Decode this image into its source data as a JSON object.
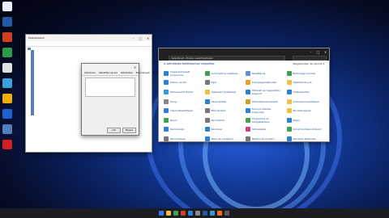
{
  "desktop_icons": [
    {
      "name": "recycle-bin-icon",
      "color": "#e8f0ff"
    },
    {
      "name": "app-icon",
      "color": "#1e5aa8"
    },
    {
      "name": "app-icon",
      "color": "#d04020"
    },
    {
      "name": "app-icon",
      "color": "#2a9d4a"
    },
    {
      "name": "app-icon",
      "color": "#e0e0e0"
    },
    {
      "name": "app-icon",
      "color": "#3aa0e0"
    },
    {
      "name": "app-icon",
      "color": "#f0b000"
    },
    {
      "name": "app-icon",
      "color": "#1e60d0"
    },
    {
      "name": "app-icon",
      "color": "#5080c0"
    },
    {
      "name": "app-icon",
      "color": "#d02020"
    }
  ],
  "device_manager": {
    "title": "Eszközkezelő",
    "items": [
      "",
      "",
      "",
      "",
      "",
      "",
      "",
      "",
      "",
      "",
      "",
      "",
      "",
      "",
      "",
      "",
      "",
      "",
      "",
      "",
      "",
      "",
      "",
      "",
      "",
      "",
      "",
      ""
    ]
  },
  "properties_dialog": {
    "title": "",
    "tabs": [
      "Általános",
      "Illesztőprogram",
      "Részletek",
      "Események",
      "Erőforrások"
    ],
    "rows": [
      {
        "k": "",
        "v": ""
      },
      {
        "k": "",
        "v": ""
      },
      {
        "k": "",
        "v": ""
      }
    ],
    "status_label": "",
    "status_text": "",
    "ok_label": "OK",
    "cancel_label": "Mégse"
  },
  "control_panel": {
    "address": "Vezérlőpult › Minden vezérlőpultelem",
    "heading": "A számítógép beállításainak megadása",
    "view_label": "Megjelenítés: Kis ikonok ▾",
    "items": [
      {
        "label": "Alapértelmezett programok",
        "color": "#2d7fd8"
      },
      {
        "label": "Automatikus lejátszás",
        "color": "#3fa34d"
      },
      {
        "label": "Beállítások",
        "color": "#5a8fd0"
      },
      {
        "label": "Biztonsági mentés",
        "color": "#3fa34d"
      },
      {
        "label": "Dátum és idő",
        "color": "#2d7fd8"
      },
      {
        "label": "Egér",
        "color": "#777"
      },
      {
        "label": "Energiagazdálkodás",
        "color": "#f0a020"
      },
      {
        "label": "Fájlelőzmények",
        "color": "#f0c040"
      },
      {
        "label": "Felhasználói fiókok",
        "color": "#3a9ad9"
      },
      {
        "label": "Fájlkezelő beállításai",
        "color": "#f0c040"
      },
      {
        "label": "Hálózati és megosztási központ",
        "color": "#2d7fd8"
      },
      {
        "label": "Hibaelhárítás",
        "color": "#2d7fd8"
      },
      {
        "label": "Hang",
        "color": "#888"
      },
      {
        "label": "Helyreállítás",
        "color": "#2d7fd8"
      },
      {
        "label": "Hitelesítőadat-kezelő",
        "color": "#c9a227"
      },
      {
        "label": "Indexelési beállítások",
        "color": "#f0c040"
      },
      {
        "label": "Internetbeállítások",
        "color": "#2d7fd8"
      },
      {
        "label": "Billentyűzet",
        "color": "#777"
      },
      {
        "label": "Könnyű kezelés központja",
        "color": "#2d7fd8"
      },
      {
        "label": "Munkamappák",
        "color": "#f0c040"
      },
      {
        "label": "Nyelv",
        "color": "#3fa34d"
      },
      {
        "label": "Nyomtatók",
        "color": "#777"
      },
      {
        "label": "Programok és szolgáltatások",
        "color": "#3fa34d"
      },
      {
        "label": "Régió",
        "color": "#2d7fd8"
      },
      {
        "label": "RemoteApp",
        "color": "#2d7fd8"
      },
      {
        "label": "Rendszer",
        "color": "#2d7fd8"
      },
      {
        "label": "Színkezelés",
        "color": "#d04080"
      },
      {
        "label": "Szinkronizálási központ",
        "color": "#3fa34d"
      },
      {
        "label": "Tárolóhelyek",
        "color": "#777"
      },
      {
        "label": "Tálca és navigáció",
        "color": "#2d7fd8"
      },
      {
        "label": "Telefon és modem",
        "color": "#777"
      },
      {
        "label": "Windows Defender",
        "color": "#2d7fd8"
      },
      {
        "label": "Windows Mobility",
        "color": "#2d7fd8"
      },
      {
        "label": "Windows Tools",
        "color": "#2d7fd8"
      },
      {
        "label": "Eszközök és nyomtatók",
        "color": "#777"
      },
      {
        "label": "Eszközkezelő",
        "color": "#777"
      }
    ]
  },
  "taskbar": {
    "apps": [
      "#3b78e7",
      "#f0c040",
      "#3fa34d",
      "#d04020",
      "#2d7fd8",
      "#8a8a8a",
      "#1e5aa8",
      "#2b9dd9",
      "#f07020",
      "#5a5a5a"
    ],
    "time": "",
    "date": ""
  }
}
